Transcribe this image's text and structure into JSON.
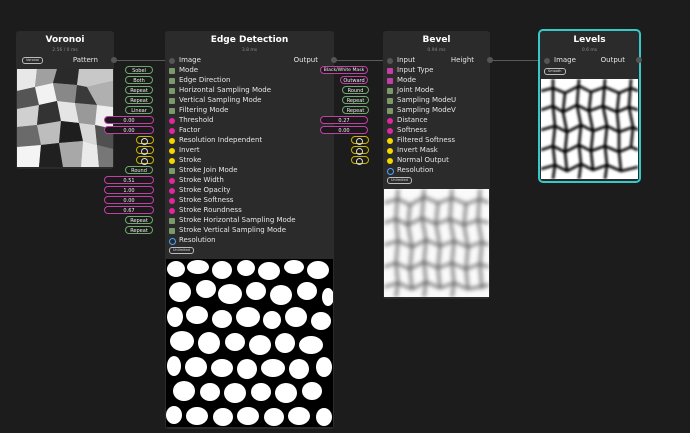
{
  "voronoi": {
    "title": "Voronoi",
    "time": "2.56 / 0 ms",
    "tag": "Voronoi",
    "output_label": "Pattern"
  },
  "edge": {
    "title": "Edge Detection",
    "time": "3.8 ms",
    "output_label": "Output",
    "tag": "Unlimited",
    "rows": [
      {
        "label": "Image"
      },
      {
        "label": "Mode",
        "value": "Sobel"
      },
      {
        "label": "Edge Direction",
        "value": "Both"
      },
      {
        "label": "Horizontal Sampling Mode",
        "value": "Repeat"
      },
      {
        "label": "Vertical Sampling Mode",
        "value": "Repeat"
      },
      {
        "label": "Filtering Mode",
        "value": "Linear"
      },
      {
        "label": "Threshold",
        "value": "0.00"
      },
      {
        "label": "Factor",
        "value": "0.00"
      },
      {
        "label": "Resolution Independent"
      },
      {
        "label": "Invert"
      },
      {
        "label": "Stroke"
      },
      {
        "label": "Stroke Join Mode",
        "value": "Round"
      },
      {
        "label": "Stroke Width",
        "value": "0.51"
      },
      {
        "label": "Stroke Opacity",
        "value": "1.00"
      },
      {
        "label": "Stroke Softness",
        "value": "0.00"
      },
      {
        "label": "Stroke Roundness",
        "value": "0.67"
      },
      {
        "label": "Stroke Horizontal Sampling Mode",
        "value": "Repeat"
      },
      {
        "label": "Stroke Vertical Sampling Mode",
        "value": "Repeat"
      },
      {
        "label": "Resolution"
      }
    ]
  },
  "bevel": {
    "title": "Bevel",
    "time": "0.94 ms",
    "output_label": "Height",
    "tag": "Unlimited",
    "rows": [
      {
        "label": "Input"
      },
      {
        "label": "Input Type",
        "value": "Black/White Mask"
      },
      {
        "label": "Mode",
        "value": "Outward"
      },
      {
        "label": "Joint Mode",
        "value": "Round"
      },
      {
        "label": "Sampling ModeU",
        "value": "Repeat"
      },
      {
        "label": "Sampling ModeV",
        "value": "Repeat"
      },
      {
        "label": "Distance",
        "value": "0.27"
      },
      {
        "label": "Softness",
        "value": "0.00"
      },
      {
        "label": "Filtered Softness"
      },
      {
        "label": "Invert Mask"
      },
      {
        "label": "Normal Output"
      },
      {
        "label": "Resolution"
      }
    ]
  },
  "levels": {
    "title": "Levels",
    "time": "0.6 ms",
    "input_label": "Image",
    "output_label": "Output",
    "tag": "Smooth"
  },
  "colors": {
    "selection": "#37c9c9",
    "socket_image": "#555555",
    "socket_enum": "#7a9a6a",
    "socket_float": "#e0279e",
    "socket_bool": "#f2d700",
    "socket_res": "#4aa6ff"
  }
}
